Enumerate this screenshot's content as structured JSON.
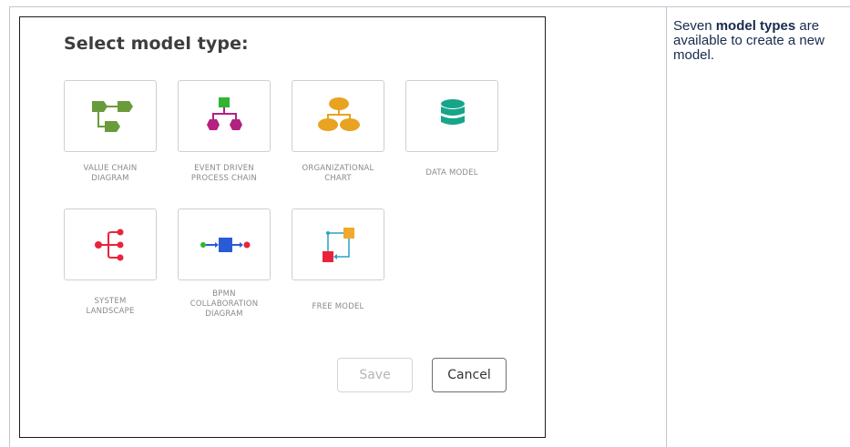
{
  "dialog": {
    "title": "Select model type:",
    "tiles": [
      {
        "label_line1": "VALUE CHAIN",
        "label_line2": "DIAGRAM",
        "label_line3": "",
        "icon": "value-chain-icon",
        "color": "#6a9b3b"
      },
      {
        "label_line1": "EVENT DRIVEN",
        "label_line2": "PROCESS CHAIN",
        "label_line3": "",
        "icon": "event-driven-process-chain-icon",
        "color_top": "#2fb52f",
        "color_bottom": "#b3227f"
      },
      {
        "label_line1": "ORGANIZATIONAL",
        "label_line2": "CHART",
        "label_line3": "",
        "icon": "org-chart-icon",
        "color": "#e8a321"
      },
      {
        "label_line1": "DATA MODEL",
        "label_line2": "",
        "label_line3": "",
        "icon": "database-icon",
        "color": "#17a589"
      },
      {
        "label_line1": "SYSTEM",
        "label_line2": "LANDSCAPE",
        "label_line3": "",
        "icon": "system-landscape-icon",
        "color": "#e8243c"
      },
      {
        "label_line1": "BPMN",
        "label_line2": "COLLABORATION",
        "label_line3": "DIAGRAM",
        "icon": "bpmn-collaboration-icon",
        "color_left": "#2fb52f",
        "color_mid": "#2a5bd7",
        "color_right": "#e8243c"
      },
      {
        "label_line1": "FREE MODEL",
        "label_line2": "",
        "label_line3": "",
        "icon": "free-model-icon",
        "color_a": "#f0a92a",
        "color_b": "#e8243c",
        "color_c": "#2aa1c7"
      }
    ],
    "buttons": {
      "save": "Save",
      "cancel": "Cancel"
    }
  },
  "note": {
    "prefix": "Seven ",
    "bold": "model types",
    "suffix": " are available to create a new model."
  }
}
